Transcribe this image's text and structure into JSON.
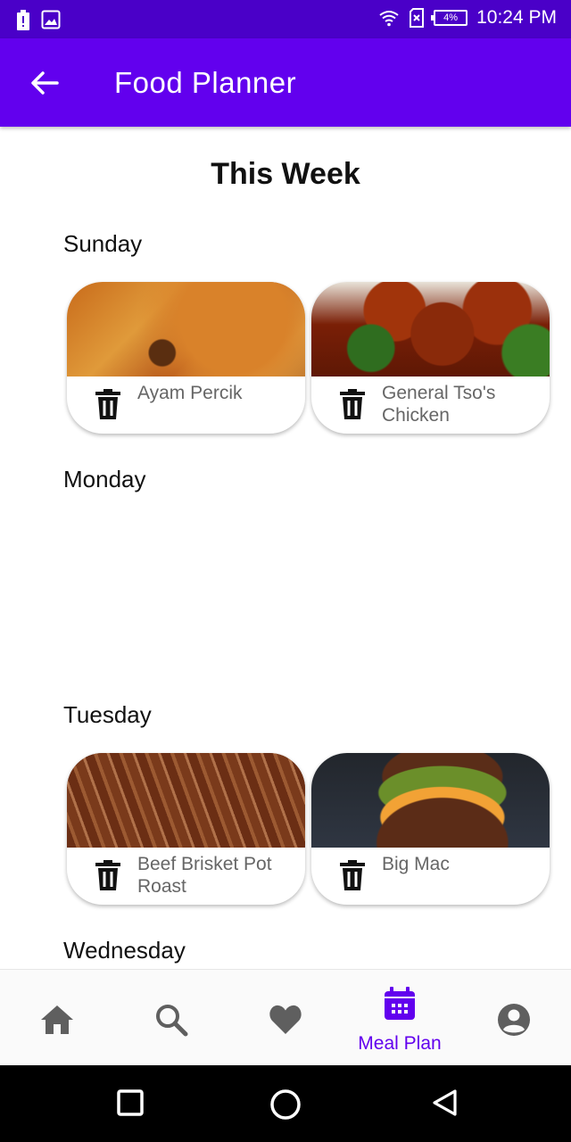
{
  "status_bar": {
    "time": "10:24 PM",
    "battery_percent": "4%",
    "icons": [
      "battery-alert-icon",
      "image-icon",
      "wifi-icon",
      "sim-error-icon",
      "battery-icon"
    ],
    "colors": {
      "background": "#4a00c8"
    }
  },
  "app_bar": {
    "title": "Food Planner",
    "back_icon": "arrow-left-icon",
    "colors": {
      "background": "#6200ee"
    }
  },
  "main": {
    "heading": "This Week",
    "days": [
      {
        "label": "Sunday",
        "meals": [
          {
            "name": "Ayam Percik",
            "delete_icon": "trash-icon"
          },
          {
            "name": "General Tso's Chicken",
            "delete_icon": "trash-icon"
          }
        ]
      },
      {
        "label": "Monday",
        "meals": []
      },
      {
        "label": "Tuesday",
        "meals": [
          {
            "name": "Beef Brisket Pot Roast",
            "delete_icon": "trash-icon"
          },
          {
            "name": "Big Mac",
            "delete_icon": "trash-icon"
          }
        ]
      },
      {
        "label": "Wednesday",
        "meals": []
      }
    ]
  },
  "bottom_nav": {
    "items": [
      {
        "icon": "home-icon",
        "label": ""
      },
      {
        "icon": "search-icon",
        "label": ""
      },
      {
        "icon": "heart-icon",
        "label": ""
      },
      {
        "icon": "calendar-icon",
        "label": "Meal Plan",
        "active": true
      },
      {
        "icon": "account-icon",
        "label": ""
      }
    ],
    "colors": {
      "active": "#6200ee",
      "inactive": "#5f5f5f"
    }
  },
  "system_nav": {
    "icons": [
      "recents-square-icon",
      "home-circle-icon",
      "back-triangle-icon"
    ]
  }
}
